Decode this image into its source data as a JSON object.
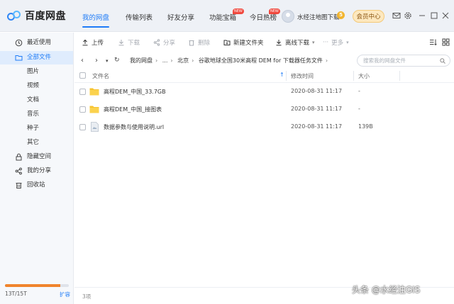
{
  "app": {
    "name": "百度网盘"
  },
  "nav": {
    "tabs": [
      {
        "label": "我的网盘"
      },
      {
        "label": "传输列表"
      },
      {
        "label": "好友分享"
      },
      {
        "label": "功能宝箱",
        "badge": "NEW"
      },
      {
        "label": "今日热榜",
        "badge": "NEW"
      }
    ]
  },
  "user": {
    "name": "水经注地图下载",
    "vip_level": "5",
    "vip_button": "会员中心"
  },
  "sidebar": {
    "items": [
      {
        "label": "最近使用",
        "icon": "clock-icon"
      },
      {
        "label": "全部文件",
        "icon": "folder-icon"
      },
      {
        "label": "图片"
      },
      {
        "label": "视频"
      },
      {
        "label": "文档"
      },
      {
        "label": "音乐"
      },
      {
        "label": "种子"
      },
      {
        "label": "其它"
      },
      {
        "label": "隐藏空间",
        "icon": "lock-icon"
      },
      {
        "label": "我的分享",
        "icon": "share-icon"
      },
      {
        "label": "回收站",
        "icon": "trash-icon"
      }
    ],
    "storage": {
      "used_text": "13T/15T",
      "used_fraction": 0.867,
      "expand_label": "扩容"
    }
  },
  "toolbar": {
    "upload": "上传",
    "download": "下载",
    "share": "分享",
    "delete": "删除",
    "new_folder": "新建文件夹",
    "offline_download": "离线下载",
    "more": "更多"
  },
  "breadcrumb": {
    "items": [
      "我的网盘",
      "...",
      "北京",
      "谷歌地球全国30米高程 DEM for 下载器任务文件"
    ],
    "search_placeholder": "搜索我的网盘文件"
  },
  "table": {
    "headers": {
      "name": "文件名",
      "modified": "修改时间",
      "size": "大小"
    },
    "rows": [
      {
        "name": "高程DEM_中国_33.7GB",
        "type": "folder",
        "modified": "2020-08-31 11:17",
        "size": "-"
      },
      {
        "name": "高程DEM_中国_接图表",
        "type": "folder",
        "modified": "2020-08-31 11:17",
        "size": "-"
      },
      {
        "name": "数据参数与使用说明.url",
        "type": "file",
        "modified": "2020-08-31 11:17",
        "size": "139B"
      }
    ]
  },
  "status": {
    "count": "3项"
  },
  "watermark": "头条 @水经注GIS",
  "colors": {
    "accent": "#1f7cf7",
    "folder": "#f7c32e",
    "storage": "#f0842d"
  }
}
